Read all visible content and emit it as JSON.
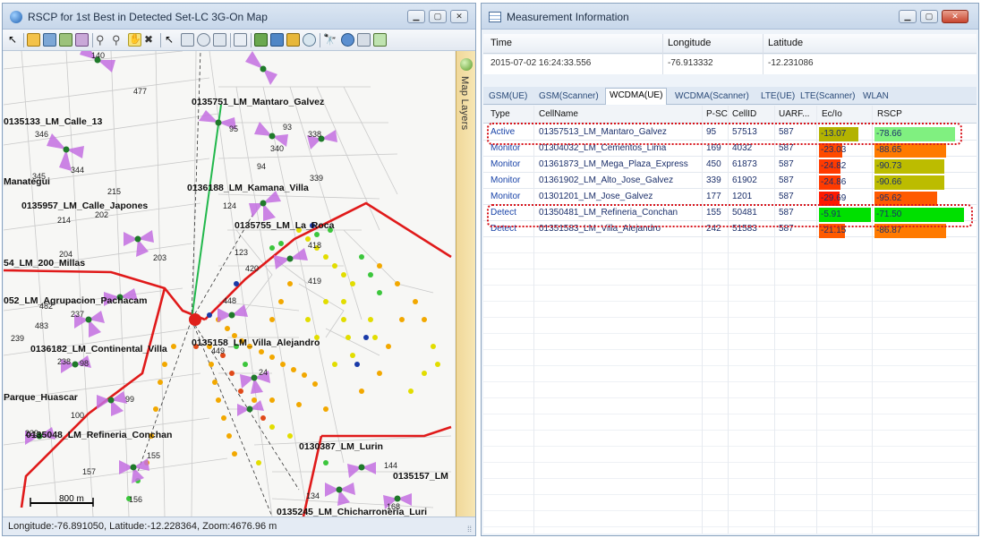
{
  "map_window": {
    "title": "RSCP for 1st Best in Detected Set-LC 3G-On Map",
    "side_panel_label": "Map Layers",
    "status": "Longitude:-76.891050, Latitude:-12.228364, Zoom:4676.96 m",
    "scale_label": "800 m",
    "site_labels": [
      "0135751_LM_Mantaro_Galvez",
      "0135133_LM_Calle_13",
      "Manategui",
      "0136188_LM_Kamana_Villa",
      "0135957_LM_Calle_Japones",
      "0135755_LM_La_Roca",
      "54_LM_200_Millas",
      "052_LM_Agrupacion_Pachacam",
      "0136182_LM_Continental_Villa",
      "0135158_LM_Villa_Alejandro",
      "Parque_Huascar",
      "0135048_LM_Refineria_Conchan",
      "0130387_LM_Lurin",
      "0135157_LM",
      "0135245_LM_Chicharroneria_Luri"
    ],
    "cell_numbers": [
      "140",
      "477",
      "346",
      "95",
      "93",
      "338",
      "340",
      "344",
      "94",
      "339",
      "345",
      "215",
      "124",
      "214",
      "202",
      "123",
      "418",
      "204",
      "203",
      "420",
      "419",
      "482",
      "448",
      "237",
      "483",
      "239",
      "449",
      "238",
      "98",
      "24",
      "99",
      "100",
      "229",
      "155",
      "157",
      "144",
      "156",
      "134",
      "168"
    ]
  },
  "measurement_window": {
    "title": "Measurement Information",
    "info_headers": [
      "Time",
      "Longitude",
      "Latitude"
    ],
    "info_values": [
      "2015-07-02 16:24:33.556",
      "-76.913332",
      "-12.231086"
    ],
    "tabs": [
      "GSM(UE)",
      "GSM(Scanner)",
      "WCDMA(UE)",
      "WCDMA(Scanner)",
      "LTE(UE)",
      "LTE(Scanner)",
      "WLAN"
    ],
    "active_tab": "WCDMA(UE)",
    "columns": [
      "Type",
      "CellName",
      "P-SC",
      "CellID",
      "UARF...",
      "Ec/Io",
      "RSCP"
    ],
    "rows": [
      {
        "type": "Active",
        "cell": "01357513_LM_Mantaro_Galvez",
        "psc": "95",
        "cellid": "57513",
        "uarfcn": "587",
        "ecio": "-13.07",
        "rscp": "-78.66",
        "ecio_color": "#b3b300",
        "rscp_color": "#80f080",
        "ecio_frac": 0.75,
        "rscp_frac": 0.9
      },
      {
        "type": "Monitor",
        "cell": "01304032_LM_Cementos_Lima",
        "psc": "169",
        "cellid": "4032",
        "uarfcn": "587",
        "ecio": "-23.03",
        "rscp": "-88.65",
        "ecio_color": "#ff4a00",
        "rscp_color": "#ff7a00",
        "ecio_frac": 0.45,
        "rscp_frac": 0.8
      },
      {
        "type": "Monitor",
        "cell": "01361873_LM_Mega_Plaza_Express",
        "psc": "450",
        "cellid": "61873",
        "uarfcn": "587",
        "ecio": "-24.82",
        "rscp": "-90.73",
        "ecio_color": "#ff3a00",
        "rscp_color": "#bcbc00",
        "ecio_frac": 0.42,
        "rscp_frac": 0.78
      },
      {
        "type": "Monitor",
        "cell": "01361902_LM_Alto_Jose_Galvez",
        "psc": "339",
        "cellid": "61902",
        "uarfcn": "587",
        "ecio": "-24.86",
        "rscp": "-90.66",
        "ecio_color": "#ff3a00",
        "rscp_color": "#bcbc00",
        "ecio_frac": 0.42,
        "rscp_frac": 0.78
      },
      {
        "type": "Monitor",
        "cell": "01301201_LM_Jose_Galvez",
        "psc": "177",
        "cellid": "1201",
        "uarfcn": "587",
        "ecio": "-29.69",
        "rscp": "-95.62",
        "ecio_color": "#ff1a00",
        "rscp_color": "#ff5a00",
        "ecio_frac": 0.4,
        "rscp_frac": 0.7
      },
      {
        "type": "Detect",
        "cell": "01350481_LM_Refineria_Conchan",
        "psc": "155",
        "cellid": "50481",
        "uarfcn": "587",
        "ecio": "-5.91",
        "rscp": "-71.50",
        "ecio_color": "#00e000",
        "rscp_color": "#00e000",
        "ecio_frac": 1.0,
        "rscp_frac": 1.0
      },
      {
        "type": "Detect",
        "cell": "01351583_LM_Villa_Alejandro",
        "psc": "242",
        "cellid": "51583",
        "uarfcn": "587",
        "ecio": "-21.15",
        "rscp": "-86.87",
        "ecio_color": "#ff5a00",
        "rscp_color": "#ff7a00",
        "ecio_frac": 0.5,
        "rscp_frac": 0.8
      }
    ]
  }
}
